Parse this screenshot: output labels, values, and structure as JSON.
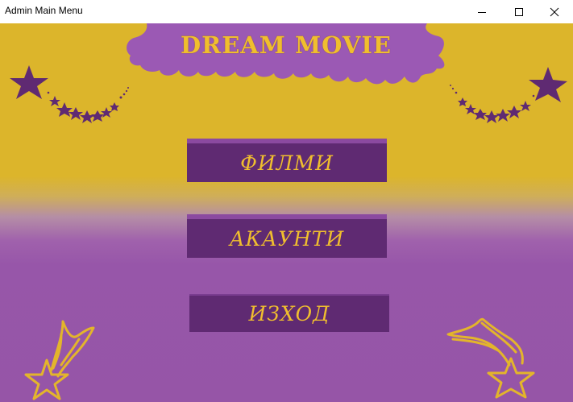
{
  "window": {
    "title": "Admin Main Menu",
    "controls": [
      "minimize-icon",
      "maximize-icon",
      "close-icon"
    ]
  },
  "banner": {
    "title": "DREAM MOVIE"
  },
  "menu": {
    "films_label": "ФИЛМИ",
    "accounts_label": "АКАУНТИ",
    "exit_label": "ИЗХОД"
  },
  "colors": {
    "background_top": "#dcb52b",
    "background_bottom": "#9655a7",
    "button_fill": "#5f2a72",
    "button_text": "#f0be2e",
    "banner_fill": "#9b59b4",
    "title_text": "#f0be2e",
    "star_purple": "#5f2a72"
  },
  "decorations": [
    "star-trail-left-icon",
    "star-trail-right-icon",
    "shooting-star-left-icon",
    "shooting-star-right-icon"
  ]
}
